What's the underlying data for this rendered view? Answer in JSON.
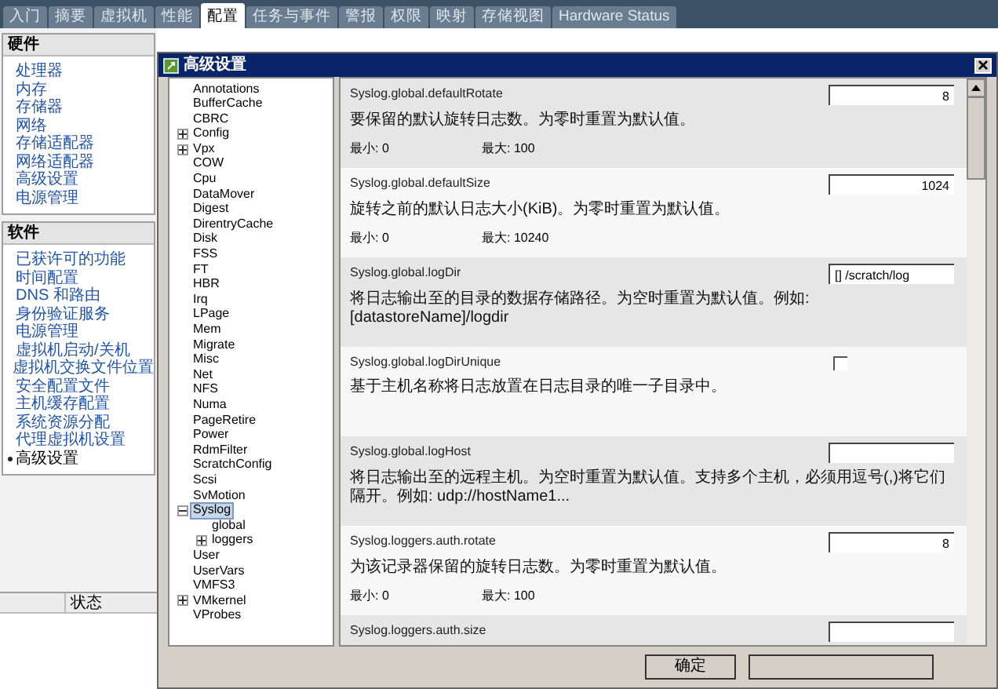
{
  "tabs": [
    {
      "label": "入门",
      "selected": false
    },
    {
      "label": "摘要",
      "selected": false
    },
    {
      "label": "虚拟机",
      "selected": false
    },
    {
      "label": "性能",
      "selected": false
    },
    {
      "label": "配置",
      "selected": true
    },
    {
      "label": "任务与事件",
      "selected": false
    },
    {
      "label": "警报",
      "selected": false
    },
    {
      "label": "权限",
      "selected": false
    },
    {
      "label": "映射",
      "selected": false
    },
    {
      "label": "存储视图",
      "selected": false
    },
    {
      "label": "Hardware Status",
      "selected": false
    }
  ],
  "sidebar": {
    "sections": [
      {
        "title": "硬件",
        "items": [
          {
            "label": "处理器",
            "selected": false
          },
          {
            "label": "内存",
            "selected": false
          },
          {
            "label": "存储器",
            "selected": false
          },
          {
            "label": "网络",
            "selected": false
          },
          {
            "label": "存储适配器",
            "selected": false
          },
          {
            "label": "网络适配器",
            "selected": false
          },
          {
            "label": "高级设置",
            "selected": false
          },
          {
            "label": "电源管理",
            "selected": false
          }
        ]
      },
      {
        "title": "软件",
        "items": [
          {
            "label": "已获许可的功能",
            "selected": false
          },
          {
            "label": "时间配置",
            "selected": false
          },
          {
            "label": "DNS 和路由",
            "selected": false
          },
          {
            "label": "身份验证服务",
            "selected": false
          },
          {
            "label": "电源管理",
            "selected": false
          },
          {
            "label": "虚拟机启动/关机",
            "selected": false
          },
          {
            "label": "虚拟机交换文件位置",
            "selected": false
          },
          {
            "label": "安全配置文件",
            "selected": false
          },
          {
            "label": "主机缓存配置",
            "selected": false
          },
          {
            "label": "系统资源分配",
            "selected": false
          },
          {
            "label": "代理虚拟机设置",
            "selected": false
          },
          {
            "label": "高级设置",
            "selected": true
          }
        ]
      }
    ]
  },
  "bottom_panel": {
    "columns": [
      "状态"
    ]
  },
  "dialog": {
    "title": "高级设置",
    "tree": [
      {
        "label": "Annotations",
        "kind": "leaf",
        "selected": false
      },
      {
        "label": "BufferCache",
        "kind": "leaf",
        "selected": false
      },
      {
        "label": "CBRC",
        "kind": "leaf",
        "selected": false
      },
      {
        "label": "Config",
        "kind": "folder",
        "expanded": false,
        "selected": false
      },
      {
        "label": "Vpx",
        "kind": "folder",
        "expanded": false,
        "selected": false
      },
      {
        "label": "COW",
        "kind": "leaf",
        "selected": false
      },
      {
        "label": "Cpu",
        "kind": "leaf",
        "selected": false
      },
      {
        "label": "DataMover",
        "kind": "leaf",
        "selected": false
      },
      {
        "label": "Digest",
        "kind": "leaf",
        "selected": false
      },
      {
        "label": "DirentryCache",
        "kind": "leaf",
        "selected": false
      },
      {
        "label": "Disk",
        "kind": "leaf",
        "selected": false
      },
      {
        "label": "FSS",
        "kind": "leaf",
        "selected": false
      },
      {
        "label": "FT",
        "kind": "leaf",
        "selected": false
      },
      {
        "label": "HBR",
        "kind": "leaf",
        "selected": false
      },
      {
        "label": "Irq",
        "kind": "leaf",
        "selected": false
      },
      {
        "label": "LPage",
        "kind": "leaf",
        "selected": false
      },
      {
        "label": "Mem",
        "kind": "leaf",
        "selected": false
      },
      {
        "label": "Migrate",
        "kind": "leaf",
        "selected": false
      },
      {
        "label": "Misc",
        "kind": "leaf",
        "selected": false
      },
      {
        "label": "Net",
        "kind": "leaf",
        "selected": false
      },
      {
        "label": "NFS",
        "kind": "leaf",
        "selected": false
      },
      {
        "label": "Numa",
        "kind": "leaf",
        "selected": false
      },
      {
        "label": "PageRetire",
        "kind": "leaf",
        "selected": false
      },
      {
        "label": "Power",
        "kind": "leaf",
        "selected": false
      },
      {
        "label": "RdmFilter",
        "kind": "leaf",
        "selected": false
      },
      {
        "label": "ScratchConfig",
        "kind": "leaf",
        "selected": false
      },
      {
        "label": "Scsi",
        "kind": "leaf",
        "selected": false
      },
      {
        "label": "SvMotion",
        "kind": "leaf",
        "selected": false
      },
      {
        "label": "Syslog",
        "kind": "folder",
        "expanded": true,
        "selected": true,
        "children": [
          {
            "label": "global",
            "kind": "leaf",
            "selected": false
          },
          {
            "label": "loggers",
            "kind": "folder",
            "expanded": false,
            "selected": false
          }
        ]
      },
      {
        "label": "User",
        "kind": "leaf",
        "selected": false
      },
      {
        "label": "UserVars",
        "kind": "leaf",
        "selected": false
      },
      {
        "label": "VMFS3",
        "kind": "leaf",
        "selected": false
      },
      {
        "label": "VMkernel",
        "kind": "folder",
        "expanded": false,
        "selected": false
      },
      {
        "label": "VProbes",
        "kind": "leaf",
        "selected": false
      }
    ],
    "settings": [
      {
        "name": "Syslog.global.defaultRotate",
        "kind": "number",
        "value": "8",
        "description": "要保留的默认旋转日志数。为零时重置为默认值。",
        "min": "最小: 0",
        "max": "最大: 100"
      },
      {
        "name": "Syslog.global.defaultSize",
        "kind": "number",
        "value": "1024",
        "description": "旋转之前的默认日志大小(KiB)。为零时重置为默认值。",
        "min": "最小: 0",
        "max": "最大: 10240"
      },
      {
        "name": "Syslog.global.logDir",
        "kind": "text",
        "value": "[] /scratch/log",
        "description": "将日志输出至的目录的数据存储路径。为空时重置为默认值。例如: [datastoreName]/logdir"
      },
      {
        "name": "Syslog.global.logDirUnique",
        "kind": "checkbox",
        "checked": false,
        "description": "基于主机名称将日志放置在日志目录的唯一子目录中。"
      },
      {
        "name": "Syslog.global.logHost",
        "kind": "text",
        "description": "将日志输出至的远程主机。为空时重置为默认值。支持多个主机，必须用逗号(,)将它们隔开。例如: udp://hostName1..."
      },
      {
        "name": "Syslog.loggers.auth.rotate",
        "kind": "number",
        "value": "8",
        "description": "为该记录器保留的旋转日志数。为零时重置为默认值。",
        "min": "最小: 0",
        "max": "最大: 100"
      },
      {
        "name": "Syslog.loggers.auth.size",
        "kind": "number"
      }
    ],
    "buttons": [
      "确定"
    ]
  }
}
